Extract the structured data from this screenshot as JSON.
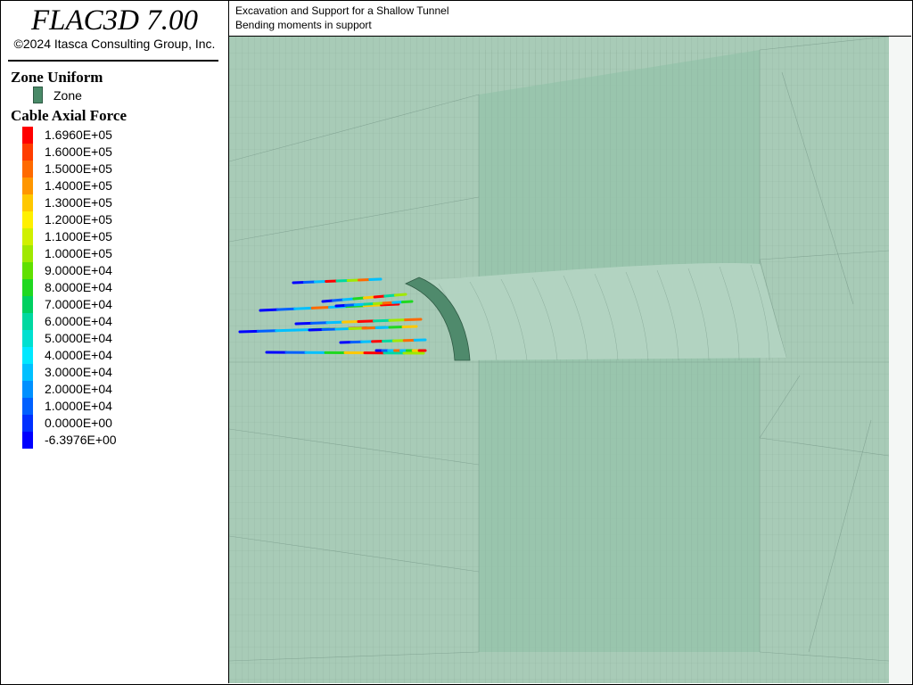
{
  "app": {
    "title": "FLAC3D 7.00",
    "copyright": "©2024 Itasca Consulting Group, Inc."
  },
  "legend": {
    "zone_heading": "Zone Uniform",
    "zone_item": {
      "label": "Zone",
      "color": "#4a8a68"
    },
    "cable_heading": "Cable Axial Force",
    "cable_scale": [
      {
        "label": "1.6960E+05",
        "color": "#ff0000"
      },
      {
        "label": "1.6000E+05",
        "color": "#ff3c00"
      },
      {
        "label": "1.5000E+05",
        "color": "#ff6a00"
      },
      {
        "label": "1.4000E+05",
        "color": "#ff9600"
      },
      {
        "label": "1.3000E+05",
        "color": "#ffc800"
      },
      {
        "label": "1.2000E+05",
        "color": "#fff000"
      },
      {
        "label": "1.1000E+05",
        "color": "#d0f000"
      },
      {
        "label": "1.0000E+05",
        "color": "#a0e800"
      },
      {
        "label": "9.0000E+04",
        "color": "#60e000"
      },
      {
        "label": "8.0000E+04",
        "color": "#20d820"
      },
      {
        "label": "7.0000E+04",
        "color": "#00d060"
      },
      {
        "label": "6.0000E+04",
        "color": "#00d8a0"
      },
      {
        "label": "5.0000E+04",
        "color": "#00e0d0"
      },
      {
        "label": "4.0000E+04",
        "color": "#00e8ff"
      },
      {
        "label": "3.0000E+04",
        "color": "#00c0ff"
      },
      {
        "label": "2.0000E+04",
        "color": "#0090ff"
      },
      {
        "label": "1.0000E+04",
        "color": "#0060ff"
      },
      {
        "label": "0.0000E+00",
        "color": "#0030ff"
      },
      {
        "label": "-6.3976E+00",
        "color": "#0000ff"
      }
    ]
  },
  "plot": {
    "title_line1": "Excavation and Support for a Shallow Tunnel",
    "title_line2": "Bending moments in support",
    "model_color": "#a2cdb5",
    "mesh_line_color": "#6e9080",
    "liner_color": "#4f8a6c",
    "cables": [
      {
        "min_force_color": "#0000ff",
        "max_force_color": "#ff0000"
      }
    ]
  }
}
